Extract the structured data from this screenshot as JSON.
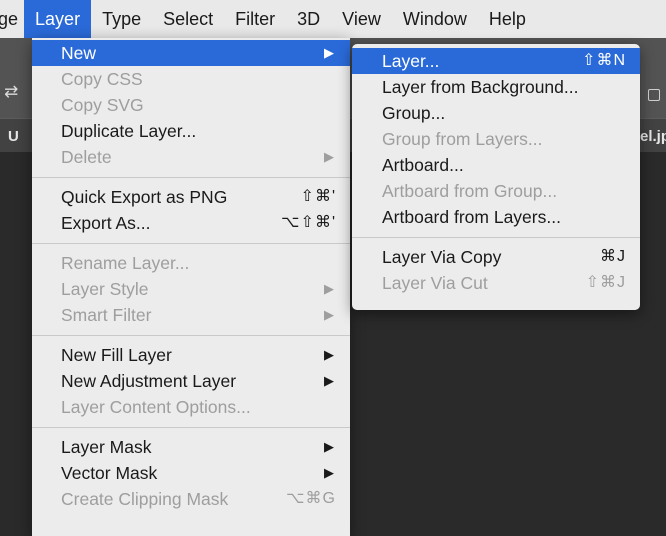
{
  "menubar": {
    "items": [
      {
        "label": "ge"
      },
      {
        "label": "Layer"
      },
      {
        "label": "Type"
      },
      {
        "label": "Select"
      },
      {
        "label": "Filter"
      },
      {
        "label": "3D"
      },
      {
        "label": "View"
      },
      {
        "label": "Window"
      },
      {
        "label": "Help"
      }
    ]
  },
  "background": {
    "tab_fragment_left": "U",
    "tab_fragment_right": "el.jp"
  },
  "layer_menu": {
    "groups": [
      [
        {
          "label": "New",
          "arrow": "▶",
          "highlight": true
        },
        {
          "label": "Copy CSS",
          "disabled": true
        },
        {
          "label": "Copy SVG",
          "disabled": true
        },
        {
          "label": "Duplicate Layer..."
        },
        {
          "label": "Delete",
          "arrow": "▶",
          "disabled": true
        }
      ],
      [
        {
          "label": "Quick Export as PNG",
          "shortcut": "⇧⌘'"
        },
        {
          "label": "Export As...",
          "shortcut": "⌥⇧⌘'"
        }
      ],
      [
        {
          "label": "Rename Layer...",
          "disabled": true
        },
        {
          "label": "Layer Style",
          "arrow": "▶",
          "disabled": true
        },
        {
          "label": "Smart Filter",
          "arrow": "▶",
          "disabled": true
        }
      ],
      [
        {
          "label": "New Fill Layer",
          "arrow": "▶"
        },
        {
          "label": "New Adjustment Layer",
          "arrow": "▶"
        },
        {
          "label": "Layer Content Options...",
          "disabled": true
        }
      ],
      [
        {
          "label": "Layer Mask",
          "arrow": "▶"
        },
        {
          "label": "Vector Mask",
          "arrow": "▶"
        },
        {
          "label": "Create Clipping Mask",
          "shortcut": "⌥⌘G",
          "disabled": true
        }
      ]
    ]
  },
  "new_submenu": {
    "groups": [
      [
        {
          "label": "Layer...",
          "shortcut": "⇧⌘N",
          "highlight": true
        },
        {
          "label": "Layer from Background..."
        },
        {
          "label": "Group..."
        },
        {
          "label": "Group from Layers...",
          "disabled": true
        },
        {
          "label": "Artboard..."
        },
        {
          "label": "Artboard from Group...",
          "disabled": true
        },
        {
          "label": "Artboard from Layers..."
        }
      ],
      [
        {
          "label": "Layer Via Copy",
          "shortcut": "⌘J"
        },
        {
          "label": "Layer Via Cut",
          "shortcut": "⇧⌘J",
          "disabled": true
        }
      ]
    ]
  }
}
